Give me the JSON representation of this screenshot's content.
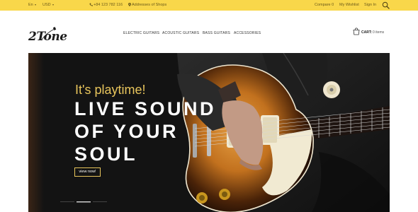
{
  "topbar": {
    "language": "En",
    "currency": "USD",
    "phone": "+84 123 782 116",
    "addresses": "Addresses of Shops",
    "compare": "Compare 0",
    "wishlist": "My Wishlist",
    "signin": "Sign In"
  },
  "header": {
    "logo_text": "2Tone",
    "nav": [
      "ELECTRIC GUITARS",
      "ACOUSTIC GUITARS",
      "BASS GUITARS",
      "ACCESSORIES"
    ],
    "cart_label": "CART:",
    "cart_count": "0 items"
  },
  "hero": {
    "tagline": "It's playtime!",
    "headline_1": "LIVE SOUND",
    "headline_2": "OF YOUR",
    "headline_3": "SOUL",
    "cta": "view now!"
  },
  "colors": {
    "topbar": "#f9d74a",
    "accent": "#e8c55c",
    "hero_bg": "#131313",
    "guitar_body": "#d98a2a",
    "guitar_burst": "#1c0d05"
  },
  "icons": [
    "phone-icon",
    "map-pin-icon",
    "search-icon",
    "cart-icon"
  ]
}
